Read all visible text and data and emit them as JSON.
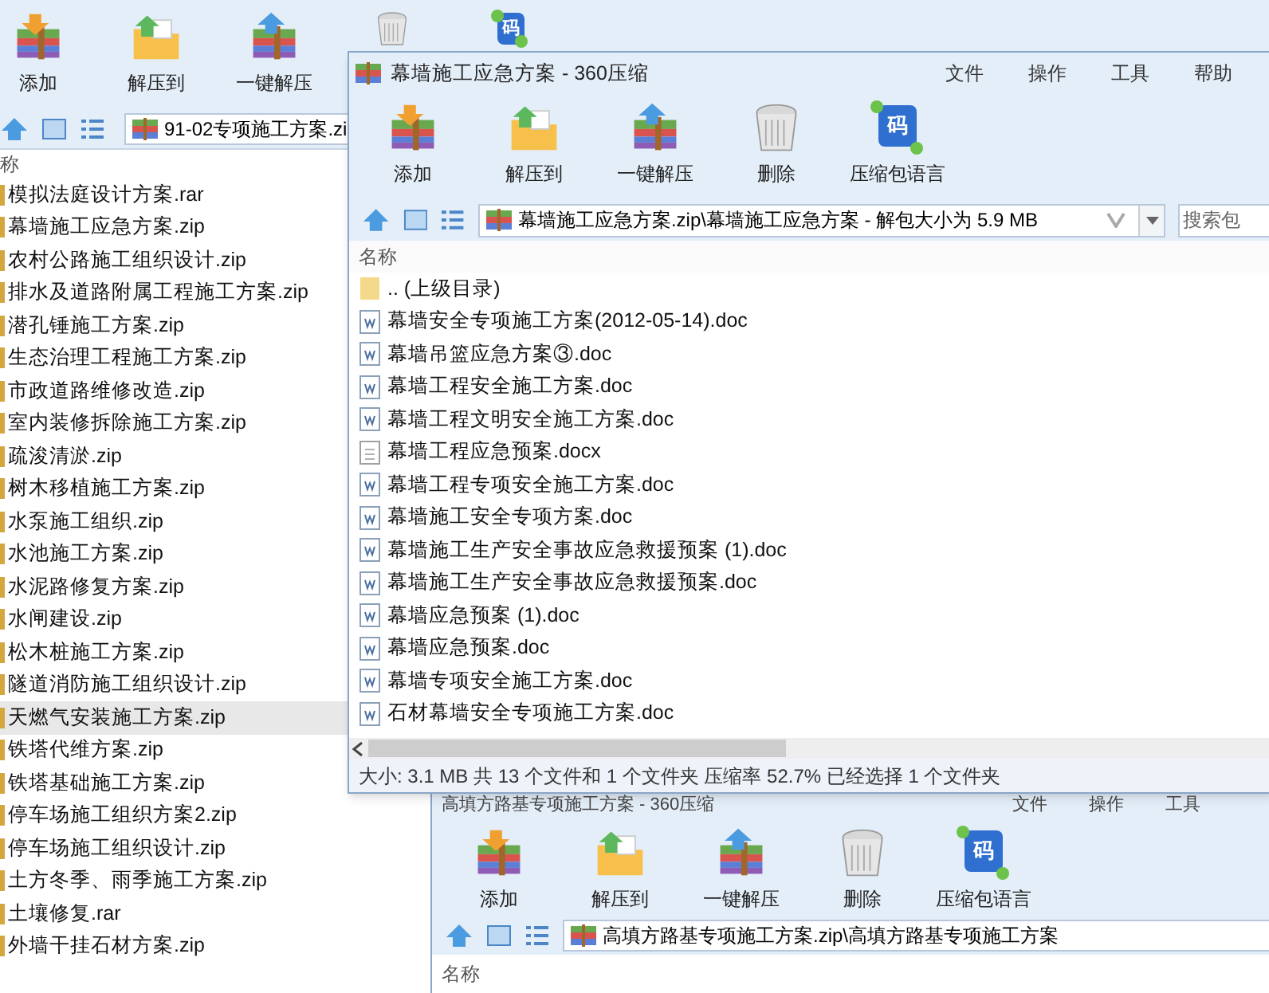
{
  "back_window": {
    "toolbar": [
      {
        "kind": "add",
        "label": "添加"
      },
      {
        "kind": "extract",
        "label": "解压到"
      },
      {
        "kind": "one_click",
        "label": "一键解压"
      },
      {
        "kind": "delete"
      },
      {
        "kind": "language",
        "glyph": "码"
      }
    ],
    "address": "91-02专项施工方案.zi",
    "column_header": "称",
    "files": [
      {
        "name": "模拟法庭设计方案.rar",
        "selected": false
      },
      {
        "name": "幕墙施工应急方案.zip",
        "selected": false
      },
      {
        "name": "农村公路施工组织设计.zip",
        "selected": false
      },
      {
        "name": "排水及道路附属工程施工方案.zip",
        "selected": false
      },
      {
        "name": "潜孔锤施工方案.zip",
        "selected": false
      },
      {
        "name": "生态治理工程施工方案.zip",
        "selected": false
      },
      {
        "name": "市政道路维修改造.zip",
        "selected": false
      },
      {
        "name": "室内装修拆除施工方案.zip",
        "selected": false
      },
      {
        "name": "疏浚清淤.zip",
        "selected": false
      },
      {
        "name": "树木移植施工方案.zip",
        "selected": false
      },
      {
        "name": "水泵施工组织.zip",
        "selected": false
      },
      {
        "name": "水池施工方案.zip",
        "selected": false
      },
      {
        "name": "水泥路修复方案.zip",
        "selected": false
      },
      {
        "name": "水闸建设.zip",
        "selected": false
      },
      {
        "name": "松木桩施工方案.zip",
        "selected": false
      },
      {
        "name": "隧道消防施工组织设计.zip",
        "selected": false
      },
      {
        "name": "天燃气安装施工方案.zip",
        "selected": true
      },
      {
        "name": "铁塔代维方案.zip",
        "selected": false
      },
      {
        "name": "铁塔基础施工方案.zip",
        "selected": false
      },
      {
        "name": "停车场施工组织方案2.zip",
        "selected": false
      },
      {
        "name": "停车场施工组织设计.zip",
        "selected": false
      },
      {
        "name": "土方冬季、雨季施工方案.zip",
        "selected": false
      },
      {
        "name": "土壤修复.rar",
        "selected": false
      },
      {
        "name": "外墙干挂石材方案.zip",
        "selected": false
      }
    ]
  },
  "front_window": {
    "title": "幕墙施工应急方案 - 360压缩",
    "menu": [
      "文件",
      "操作",
      "工具",
      "帮助"
    ],
    "toolbar": [
      {
        "kind": "add",
        "label": "添加"
      },
      {
        "kind": "extract",
        "label": "解压到"
      },
      {
        "kind": "one_click",
        "label": "一键解压"
      },
      {
        "kind": "delete",
        "label": "删除"
      },
      {
        "kind": "language",
        "label": "压缩包语言",
        "glyph": "码"
      }
    ],
    "address": "幕墙施工应急方案.zip\\幕墙施工应急方案 - 解包大小为 5.9 MB",
    "search": {
      "placeholder": "搜索包"
    },
    "column_header": "名称",
    "files": [
      {
        "kind": "parent",
        "name": ".. (上级目录)"
      },
      {
        "kind": "doc",
        "name": "幕墙安全专项施工方案(2012-05-14).doc"
      },
      {
        "kind": "doc",
        "name": "幕墙吊篮应急方案③.doc"
      },
      {
        "kind": "doc",
        "name": "幕墙工程安全施工方案.doc"
      },
      {
        "kind": "doc",
        "name": "幕墙工程文明安全施工方案.doc"
      },
      {
        "kind": "text",
        "name": "幕墙工程应急预案.docx"
      },
      {
        "kind": "doc",
        "name": "幕墙工程专项安全施工方案.doc"
      },
      {
        "kind": "doc",
        "name": "幕墙施工安全专项方案.doc"
      },
      {
        "kind": "doc",
        "name": "幕墙施工生产安全事故应急救援预案 (1).doc"
      },
      {
        "kind": "doc",
        "name": "幕墙施工生产安全事故应急救援预案.doc"
      },
      {
        "kind": "doc",
        "name": "幕墙应急预案 (1).doc"
      },
      {
        "kind": "doc",
        "name": "幕墙应急预案.doc"
      },
      {
        "kind": "doc",
        "name": "幕墙专项安全施工方案.doc"
      },
      {
        "kind": "doc",
        "name": "石材幕墙安全专项施工方案.doc"
      }
    ],
    "status": "大小: 3.1 MB 共 13 个文件和 1 个文件夹 压缩率 52.7% 已经选择 1 个文件夹"
  },
  "lower_window": {
    "title": "高填方路基专项施工方案 - 360压缩",
    "menu": [
      "文件",
      "操作",
      "工具"
    ],
    "toolbar": [
      {
        "kind": "add",
        "label": "添加"
      },
      {
        "kind": "extract",
        "label": "解压到"
      },
      {
        "kind": "one_click",
        "label": "一键解压"
      },
      {
        "kind": "delete",
        "label": "删除"
      },
      {
        "kind": "language",
        "label": "压缩包语言",
        "glyph": "码"
      }
    ],
    "address": "高填方路基专项施工方案.zip\\高填方路基专项施工方案",
    "column_header": "名称"
  }
}
